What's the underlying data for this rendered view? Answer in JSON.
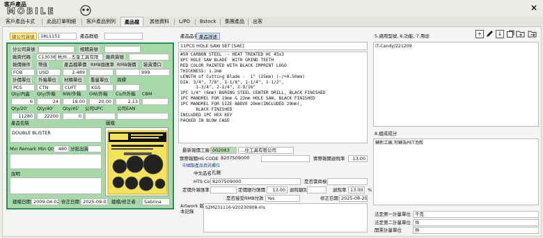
{
  "window": {
    "title": "客戶產品",
    "logo_text": "MOBILE",
    "close_label": "×"
  },
  "tabs": [
    "客戶產品卡式",
    "此品訂單明細",
    "客戶產品例列",
    "產品檔",
    "其他資料",
    "L/PO",
    "Bstock",
    "集團產品",
    "出客"
  ],
  "active_tab": 3,
  "product": {
    "customer_no_label": "總公司貨號",
    "customer_no": "18L1151",
    "product_group_label": "產品群組",
    "product_group": "",
    "name_label": "產品品名",
    "name_badge": "產品詳述",
    "name_value": "11PCS HOLE SAW SET [SAE]",
    "description": "#50 CARBON STEEL -- HEAT TREATED HC 45±3\n8PC HOLE SAW BLADE  WITH GRIND TEETH\nRED COLOR PAINTED WITH BLACK IMPRINT LOGO\nTHICKNESS: 1.2mm\nLENGTH of Cutting Blade -  1\" (25mm) (-/+0.50mm)\nDIA. 3/4\", 7/8\", 1-1/8\", 1-1/4\", 1-1/2\",\n      1-3/4\", 2-1/4\", 2-9/16\"\n1PC 1/4\" (6mm) BORING STEEL CENTER DRILL, BLACK FINISHED\n1PC MANDREL FOR 19mm & 22mm HOLE SAW, BLACK FINISHED\n1PC MANDREL FOR SIZE ABOVE 29mm(INCLUDED 29mm),\n      BLACK FINISHED\nINCLUDED 1PC HEX KEY\nPACKED IN BLOW CASE"
  },
  "left": {
    "branch_no_label": "分公司貨號",
    "related_no_label": "相關貨號",
    "vendor_code_label": "廠商代碼",
    "vendor_code": "C13038",
    "vendor_name": "杭州…五金工具有限",
    "vendor_no_label": "廠商貨號",
    "vendor_no": "",
    "quote_cond_label": "報價條件",
    "currency_label": "幣值",
    "unit_price_label": "產品檔單價",
    "rmb_rate_label": "RMB換匯率",
    "rmb_quote_label": "RMB報價",
    "port_label": "裝貨港口",
    "quote_cond": "FOB",
    "currency": "USD",
    "unit_price": "2.489",
    "rmb_rate": "",
    "rmb_quote": "",
    "port": "999",
    "calc_unit_label": "計價單位",
    "outer_unit_label": "外箱單位",
    "material_weight_label": "材積單位",
    "gross_unit_label": "重量單位",
    "trademark_label": "商標",
    "calc_unit": "PCS",
    "outer_unit": "CTN",
    "material_weight": "CUFT",
    "gross_unit": "KGS",
    "trademark": "",
    "qty_inner_label": "Qty/內盒",
    "qty_outer_label": "Qty/外箱",
    "nw_label": "NW/外箱",
    "gw_label": "GW/外箱",
    "cuft_label": "Cu/ft外箱",
    "cbm_label": "CBM",
    "qty_inner": "6",
    "qty_outer": "24",
    "nw": "19.00",
    "gw": "20.00",
    "cuft": "2.13",
    "cbm": "",
    "qty20_label": "Qty/20'",
    "qty40_label": "Qty/40'",
    "qty45_label": "Qty/45'",
    "upc_label": "公司UPC",
    "ean_label": "公司EAN",
    "qty20": "11280",
    "qty40": "22200",
    "qty45": "0",
    "upc": "",
    "ean": "",
    "packing_label": "產品包裝",
    "image_label": "圖檔",
    "packing": "DOUBLE BLISTER",
    "min_remark_label": "Min Remark Min Qty",
    "min_qty": "480",
    "batch_label": "分批出貨",
    "note_label": "說明",
    "created_label": "建檔日期",
    "created": "2009-04-02",
    "modified_label": "修正日期",
    "modified": "2025-09-03",
    "modifier_label": "建檔/修正者",
    "modifier": "Sabrina"
  },
  "mid": {
    "latest_vendor_label": "最新報價工廠",
    "latest_vendor_code": "002083",
    "latest_vendor_name": "…仕工具有限公司",
    "hs_label": "實際報關HS CODE",
    "hs_code": "8207509000",
    "tax_label": "實際報關退稅率",
    "tax_rate": "13.00",
    "china_section": "中國製產品資訊欄位",
    "cn_name_label": "中文品名",
    "cn_name": "孔鋸",
    "hs2_label": "HTS Code",
    "hs2": "8207509000",
    "is_trademark_label": "是否需商檢",
    "fixed_rate_label": "定價外貿匯率",
    "fixed_tax_label": "定價銀行匯價",
    "fixed_tax": "13.00",
    "refund_label": "退稅額別",
    "refund_rate_label": "退稅率",
    "refund_rate": "13.00",
    "pct": "%",
    "rmb_label": "是否接受RMB付款",
    "rmb_value": "Yes",
    "mod_label": "修正日期",
    "mod_value": "2025-08-20",
    "artwork_label": "Artwork 版本記錄",
    "artwork": "S2M231116-V20230908-Iris"
  },
  "right": {
    "usage_label": "5.適用型號, 6.功能, 7.用途",
    "usage": "IT-Candy/221209",
    "component_label": "8.組成成分",
    "component": "轉新工廠,可轉為PET泡殼",
    "unit1_label": "法定第一計量單位",
    "unit1": "千克",
    "unit2_label": "法定第二計量單位",
    "unit2": "件",
    "unit3_label": "開票計量單位",
    "unit3": "件"
  },
  "colors": {
    "left_panel": "#a6d8a9",
    "left_border": "#2e8b57",
    "highlight": "#b6ddb0",
    "active_yellow": "#fff7b5"
  }
}
